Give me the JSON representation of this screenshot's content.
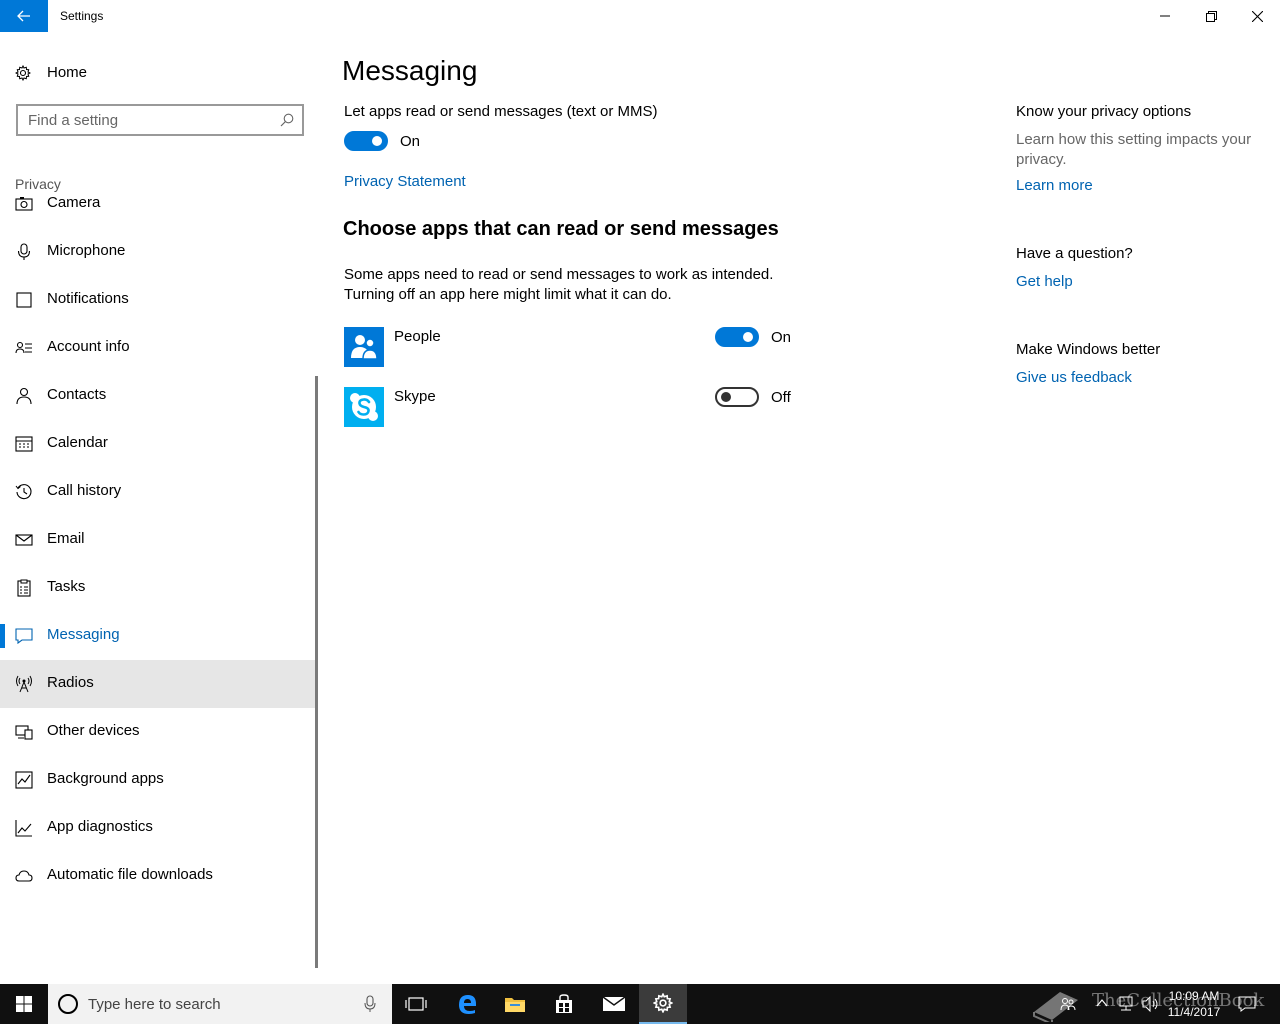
{
  "window": {
    "title": "Settings"
  },
  "sidebar": {
    "home_label": "Home",
    "search_placeholder": "Find a setting",
    "section_label": "Privacy",
    "items": [
      {
        "label": "Camera",
        "icon": "camera-icon"
      },
      {
        "label": "Microphone",
        "icon": "microphone-icon"
      },
      {
        "label": "Notifications",
        "icon": "notifications-icon"
      },
      {
        "label": "Account info",
        "icon": "account-info-icon"
      },
      {
        "label": "Contacts",
        "icon": "contacts-icon"
      },
      {
        "label": "Calendar",
        "icon": "calendar-icon"
      },
      {
        "label": "Call history",
        "icon": "call-history-icon"
      },
      {
        "label": "Email",
        "icon": "email-icon"
      },
      {
        "label": "Tasks",
        "icon": "tasks-icon"
      },
      {
        "label": "Messaging",
        "icon": "messaging-icon",
        "selected": true
      },
      {
        "label": "Radios",
        "icon": "radios-icon",
        "hover": true
      },
      {
        "label": "Other devices",
        "icon": "other-devices-icon"
      },
      {
        "label": "Background apps",
        "icon": "background-apps-icon"
      },
      {
        "label": "App diagnostics",
        "icon": "app-diagnostics-icon"
      },
      {
        "label": "Automatic file downloads",
        "icon": "cloud-icon"
      }
    ]
  },
  "main": {
    "title": "Messaging",
    "master_description": "Let apps read or send messages (text or MMS)",
    "master_toggle": {
      "state": "On",
      "on": true
    },
    "privacy_link": "Privacy Statement",
    "apps_heading": "Choose apps that can read or send messages",
    "apps_paragraph_line1": "Some apps need to read or send messages to work as intended.",
    "apps_paragraph_line2": "Turning off an app here might limit what it can do.",
    "apps": [
      {
        "name": "People",
        "state": "On",
        "on": true,
        "icon": "people-icon",
        "color": "#0078d7"
      },
      {
        "name": "Skype",
        "state": "Off",
        "on": false,
        "icon": "skype-icon",
        "color": "#00aff0"
      }
    ]
  },
  "right_column": {
    "privacy_heading": "Know your privacy options",
    "privacy_text": "Learn how this setting impacts your privacy.",
    "learn_more": "Learn more",
    "question_heading": "Have a question?",
    "get_help": "Get help",
    "feedback_heading": "Make Windows better",
    "feedback_link": "Give us feedback"
  },
  "taskbar": {
    "search_placeholder": "Type here to search",
    "time": "10:09 AM",
    "date": "11/4/2017",
    "watermark": "TheCollectionBook"
  },
  "colors": {
    "accent": "#0078d7",
    "link": "#0063b1"
  }
}
